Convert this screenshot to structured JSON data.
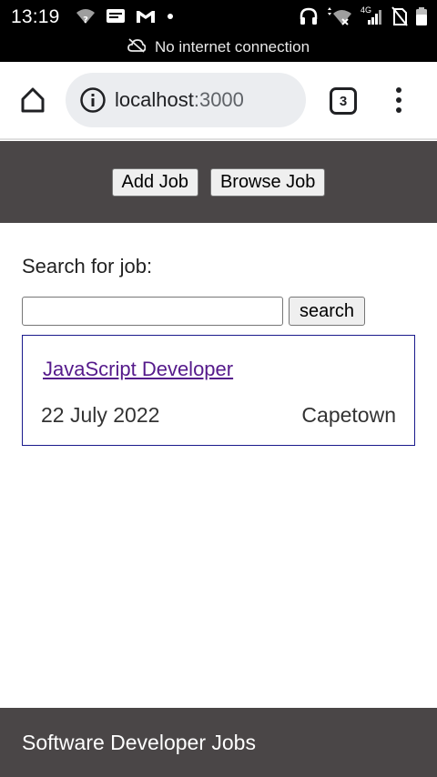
{
  "status_bar": {
    "time": "13:19",
    "network_label": "4G",
    "left_icons": [
      "wifi-question-icon",
      "message-icon",
      "gmail-icon",
      "dot-icon"
    ],
    "right_icons": [
      "headphones-icon",
      "wifi-off-icon",
      "signal-icon",
      "no-sim-icon",
      "battery-icon"
    ]
  },
  "offline_banner": {
    "text": "No internet connection",
    "icon": "cloud-off-icon"
  },
  "browser": {
    "url_host": "localhost",
    "url_port": ":3000",
    "tab_count": "3"
  },
  "header": {
    "add_job_label": "Add Job",
    "browse_job_label": "Browse Job"
  },
  "search": {
    "label": "Search for job:",
    "value": "",
    "button_label": "search"
  },
  "jobs": [
    {
      "title": "JavaScript Developer",
      "date": "22 July 2022",
      "location": "Capetown"
    }
  ],
  "footer": {
    "text": "Software Developer Jobs"
  },
  "colors": {
    "header_bg": "#4a4647",
    "link": "#551a8b",
    "card_border": "#1a1a8c"
  }
}
